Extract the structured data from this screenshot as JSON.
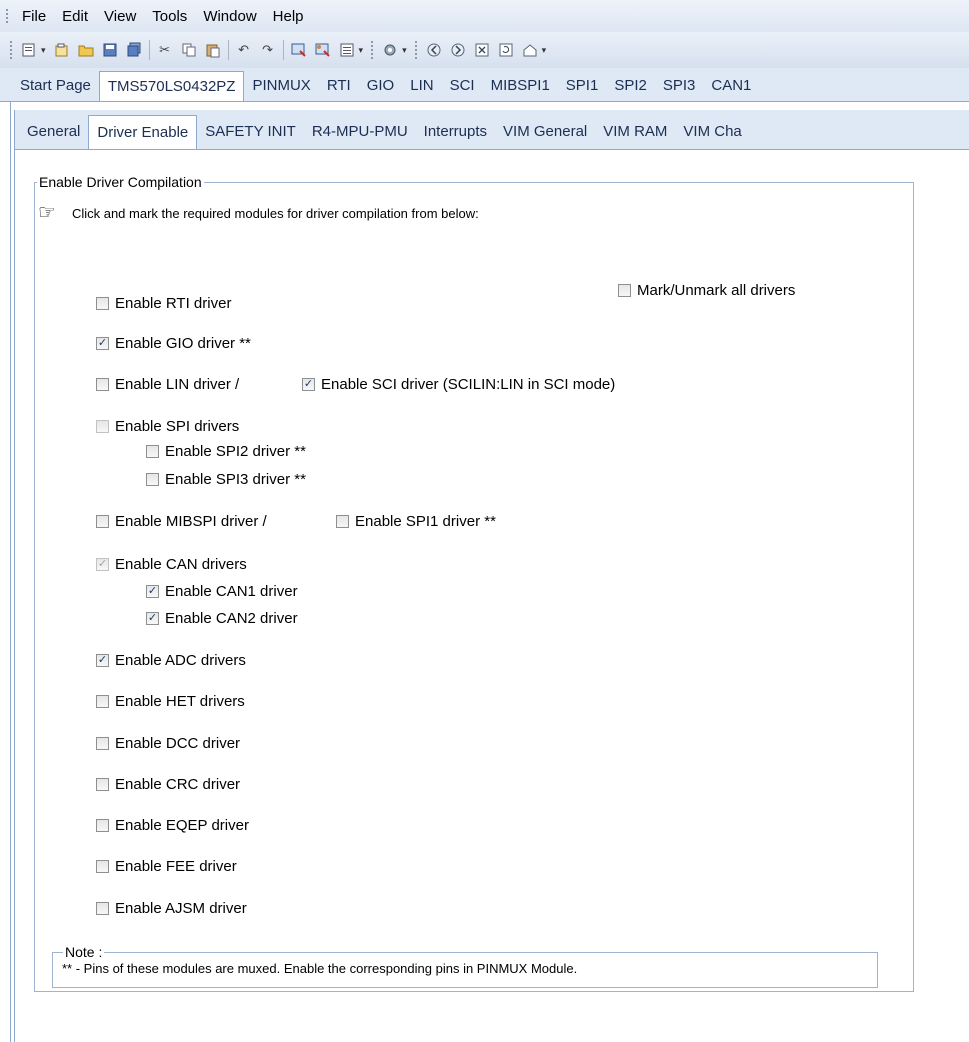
{
  "menu": [
    "File",
    "Edit",
    "View",
    "Tools",
    "Window",
    "Help"
  ],
  "toolbar": {
    "icons": [
      "new-project-icon",
      "open-icon",
      "open-folder-icon",
      "save-icon",
      "save-all-icon",
      "cut-icon",
      "copy-icon",
      "paste-icon",
      "undo-icon",
      "redo-icon",
      "generate-code-icon",
      "generate-all-icon",
      "document-icon",
      "settings-icon",
      "back-icon",
      "forward-icon",
      "close-icon",
      "refresh-icon",
      "home-icon"
    ]
  },
  "main_tabs": [
    "Start Page",
    "TMS570LS0432PZ",
    "PINMUX",
    "RTI",
    "GIO",
    "LIN",
    "SCI",
    "MIBSPI1",
    "SPI1",
    "SPI2",
    "SPI3",
    "CAN1"
  ],
  "main_tabs_active": 1,
  "sub_tabs": [
    "General",
    "Driver Enable",
    "SAFETY INIT",
    "R4-MPU-PMU",
    "Interrupts",
    "VIM General",
    "VIM RAM",
    "VIM Cha"
  ],
  "sub_tabs_active": 1,
  "group": {
    "title": "Enable Driver Compilation",
    "hint": "Click and mark the required modules for driver compilation from below:"
  },
  "checkboxes": {
    "mark_all": {
      "label": "Mark/Unmark all drivers",
      "checked": false
    },
    "rti": {
      "label": "Enable RTI driver",
      "checked": false
    },
    "gio": {
      "label": "Enable GIO driver **",
      "checked": true
    },
    "lin": {
      "label": "Enable LIN driver /",
      "checked": false
    },
    "sci": {
      "label": "Enable SCI driver (SCILIN:LIN in SCI mode)",
      "checked": true
    },
    "spi": {
      "label": "Enable SPI drivers",
      "checked": false,
      "disabled": true
    },
    "spi2": {
      "label": "Enable SPI2 driver **",
      "checked": false
    },
    "spi3": {
      "label": "Enable SPI3 driver **",
      "checked": false
    },
    "mibspi": {
      "label": "Enable MIBSPI driver /",
      "checked": false
    },
    "spi1": {
      "label": "Enable SPI1 driver **",
      "checked": false
    },
    "can": {
      "label": "Enable CAN drivers",
      "checked": true,
      "disabled": true
    },
    "can1": {
      "label": "Enable CAN1 driver",
      "checked": true
    },
    "can2": {
      "label": "Enable CAN2 driver",
      "checked": true
    },
    "adc": {
      "label": "Enable ADC drivers",
      "checked": true
    },
    "het": {
      "label": "Enable HET drivers",
      "checked": false
    },
    "dcc": {
      "label": "Enable DCC driver",
      "checked": false
    },
    "crc": {
      "label": "Enable CRC driver",
      "checked": false
    },
    "eqep": {
      "label": "Enable EQEP driver",
      "checked": false
    },
    "fee": {
      "label": "Enable FEE driver",
      "checked": false
    },
    "ajsm": {
      "label": "Enable AJSM driver",
      "checked": false
    }
  },
  "note": {
    "title": "Note :",
    "text": "** - Pins of these modules are muxed. Enable the corresponding pins in PINMUX Module."
  }
}
